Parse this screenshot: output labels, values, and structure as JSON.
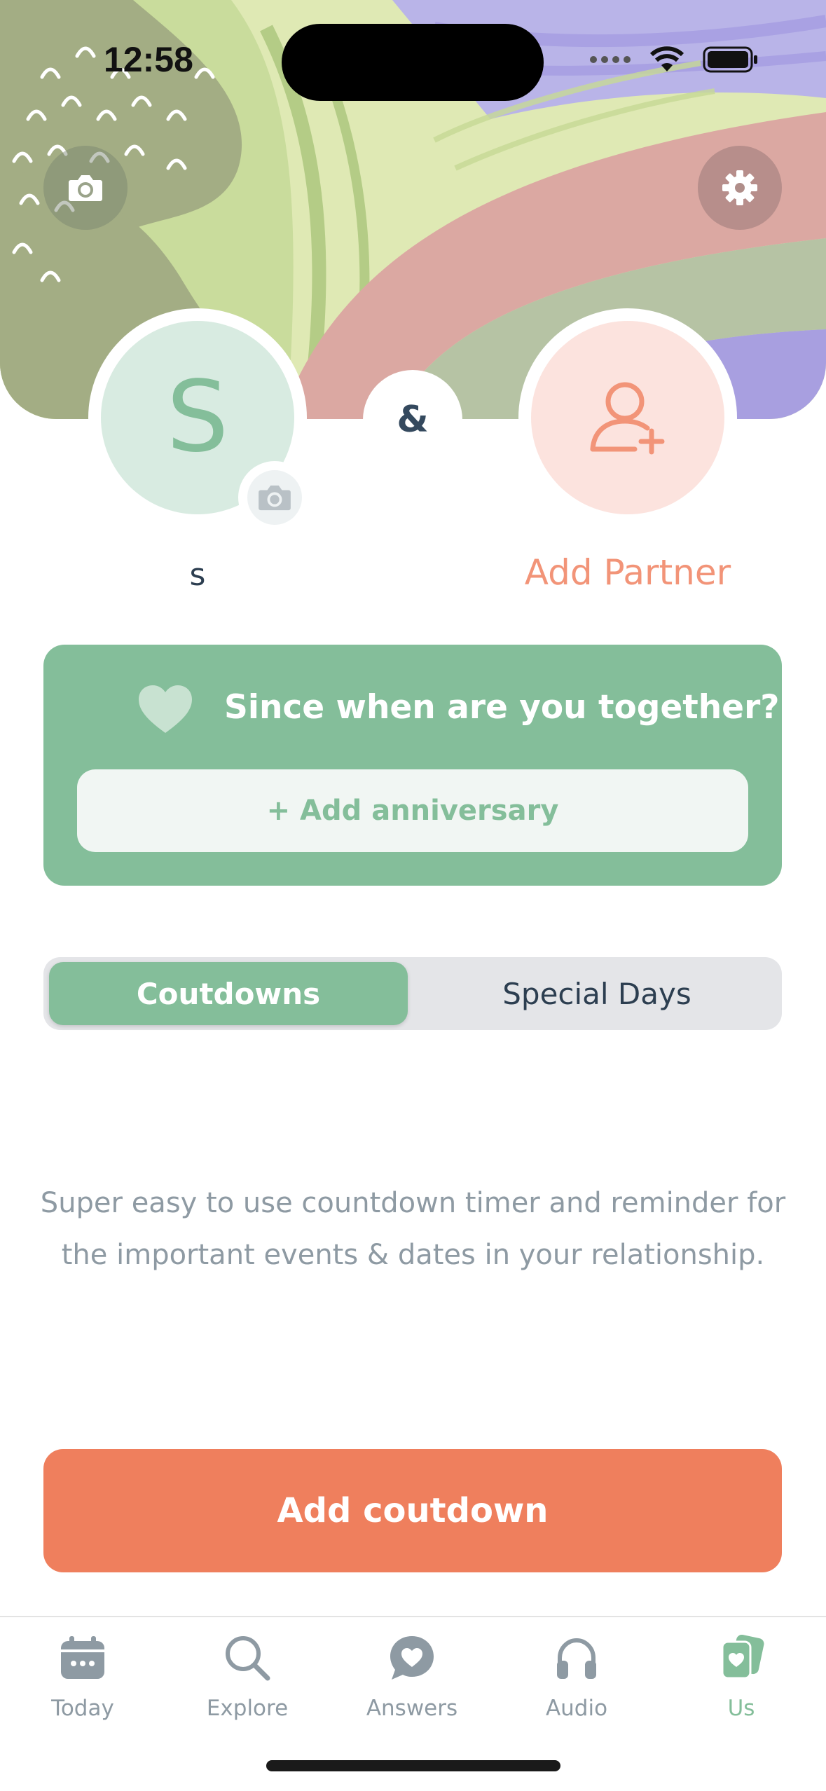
{
  "status_bar": {
    "time": "12:58"
  },
  "profile": {
    "me": {
      "initial": "S",
      "name": "s"
    },
    "connector": "&",
    "partner": {
      "label": "Add Partner"
    }
  },
  "anniversary": {
    "title": "Since when are you together?",
    "button": "+ Add anniversary"
  },
  "segmented": {
    "tabs": [
      {
        "label": "Coutdowns",
        "active": true
      },
      {
        "label": "Special Days",
        "active": false
      }
    ]
  },
  "description": "Super easy to use countdown timer and reminder for the important events & dates in your relationship.",
  "cta": {
    "label": "Add coutdown"
  },
  "tab_bar": {
    "items": [
      {
        "label": "Today",
        "icon": "calendar-icon",
        "active": false
      },
      {
        "label": "Explore",
        "icon": "search-icon",
        "active": false
      },
      {
        "label": "Answers",
        "icon": "chat-heart-icon",
        "active": false
      },
      {
        "label": "Audio",
        "icon": "headphones-icon",
        "active": false
      },
      {
        "label": "Us",
        "icon": "cards-heart-icon",
        "active": true
      }
    ]
  },
  "colors": {
    "brand_green": "#84be9a",
    "accent_orange": "#ef7f5d",
    "partner_pink": "#f29478",
    "text_dark": "#2c3e50",
    "text_muted": "#8e9aa3"
  }
}
